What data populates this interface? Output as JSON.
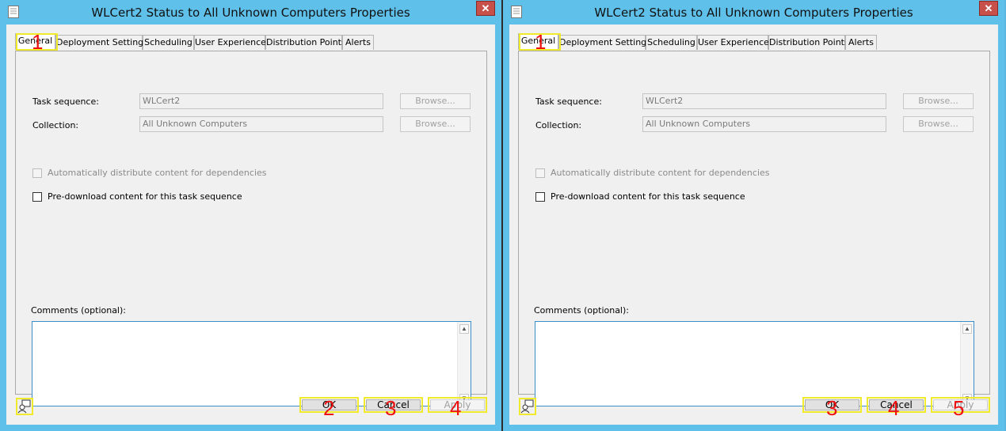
{
  "windows": [
    {
      "title": "WLCert2 Status to All Unknown Computers Properties",
      "close_label": "✕",
      "tabs": [
        "General",
        "Deployment Settings",
        "Scheduling",
        "User Experience",
        "Distribution Points",
        "Alerts"
      ],
      "task_sequence_label": "Task sequence:",
      "task_sequence_value": "WLCert2",
      "collection_label": "Collection:",
      "collection_value": "All Unknown Computers",
      "browse_label": "Browse...",
      "auto_distribute_label": "Automatically distribute content for dependencies",
      "predownload_label": "Pre-download content for this task sequence",
      "comments_label": "Comments (optional):",
      "ok_label": "OK",
      "cancel_label": "Cancel",
      "apply_label": "Apply",
      "marks": {
        "tab": "1",
        "ok": "2",
        "cancel": "3",
        "apply": "4"
      }
    },
    {
      "title": "WLCert2 Status to All Unknown Computers Properties",
      "close_label": "✕",
      "tabs": [
        "General",
        "Deployment Settings",
        "Scheduling",
        "User Experience",
        "Distribution Points",
        "Alerts"
      ],
      "task_sequence_label": "Task sequence:",
      "task_sequence_value": "WLCert2",
      "collection_label": "Collection:",
      "collection_value": "All Unknown Computers",
      "browse_label": "Browse...",
      "auto_distribute_label": "Automatically distribute content for dependencies",
      "predownload_label": "Pre-download content for this task sequence",
      "comments_label": "Comments (optional):",
      "ok_label": "OK",
      "cancel_label": "Cancel",
      "apply_label": "Apply",
      "marks": {
        "tab": "1",
        "ok": "3",
        "cancel": "4",
        "apply": "5"
      }
    }
  ],
  "colors": {
    "title_bar": "#5fc0ea",
    "annotation_box": "#f1ea2a",
    "annotation_number": "#e11111"
  }
}
